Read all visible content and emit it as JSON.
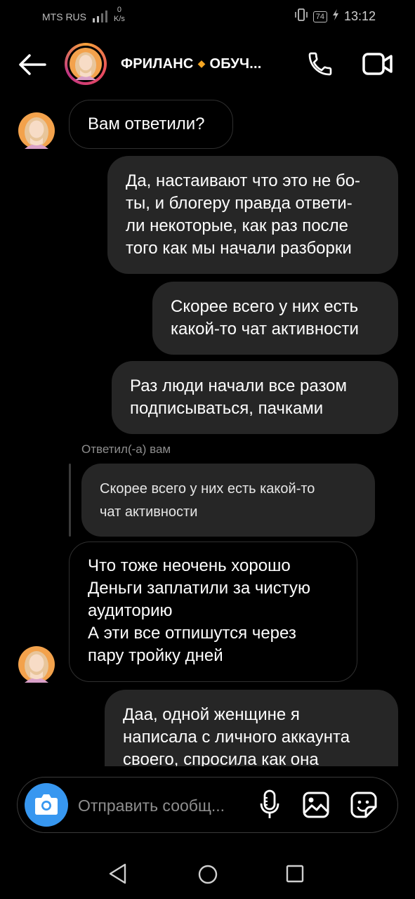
{
  "status_bar": {
    "carrier": "MTS RUS",
    "net_speed_value": "0",
    "net_speed_unit": "K/s",
    "battery": "74",
    "time": "13:12"
  },
  "header": {
    "title_left": "ФРИЛАНС",
    "title_right": "ОБУЧ...",
    "colors": {
      "accent_dot": "#f5a623"
    }
  },
  "messages": [
    {
      "from": "them",
      "text": "Вам ответили?"
    },
    {
      "from": "me",
      "text": "Да, настаивают что это не бо-\nты, и блогеру правда ответи-\nли некоторые, как раз после\nтого как мы начали разборки"
    },
    {
      "from": "me",
      "text": "Скорее всего у них есть\nкакой-то чат активности"
    },
    {
      "from": "me",
      "text": "Раз люди начали  все разом\nподписываться, пачками"
    },
    {
      "from": "them",
      "text": "Что тоже неочень хорошо\nДеньги заплатили за чистую\nаудиторию\nА эти все отпишутся через\nпару тройку дней"
    },
    {
      "from": "me",
      "text": "Даа, одной женщине я\nнаписала с личного аккаунта\nсвоего, спросила как она"
    }
  ],
  "reply": {
    "label": "Ответил(-а) вам",
    "quoted_text": "Скорее всего у них есть какой-то\nчат активности"
  },
  "composer": {
    "placeholder": "Отправить сообщ...",
    "value": "",
    "colors": {
      "camera_button": "#3797f0"
    }
  },
  "icons": {
    "header": [
      "back-arrow-icon",
      "phone-icon",
      "video-call-icon"
    ],
    "composer": [
      "camera-icon",
      "microphone-icon",
      "gallery-icon",
      "sticker-icon"
    ],
    "nav": [
      "nav-back-icon",
      "nav-home-icon",
      "nav-recents-icon"
    ]
  }
}
